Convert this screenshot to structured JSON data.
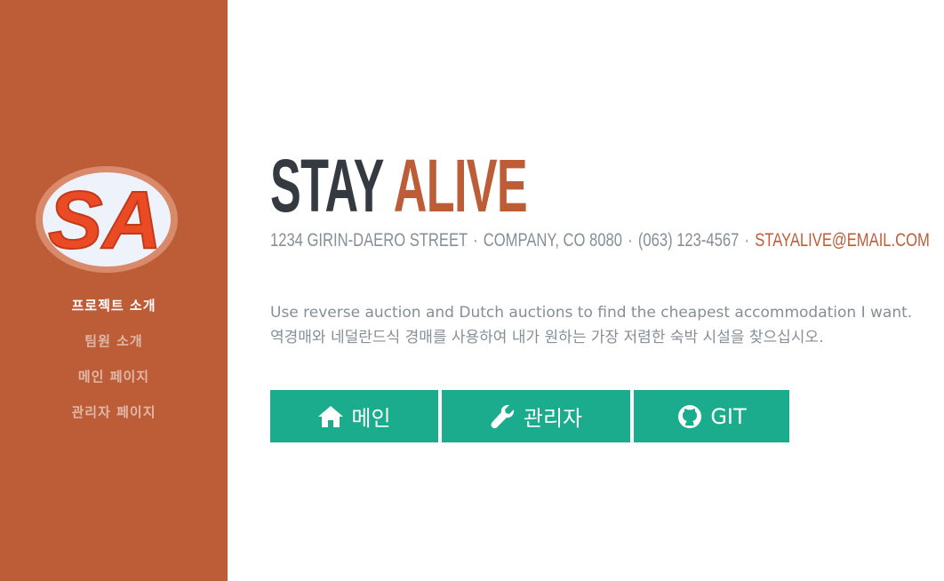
{
  "sidebar": {
    "logo_text": "SA",
    "nav": [
      {
        "label": "프로젝트 소개",
        "active": true
      },
      {
        "label": "팀원 소개",
        "active": false
      },
      {
        "label": "메인 페이지",
        "active": false
      },
      {
        "label": "관리자 페이지",
        "active": false
      }
    ]
  },
  "main": {
    "title_part1": "STAY",
    "title_part2": "ALIVE",
    "subheading": {
      "address": "1234 GIRIN-DAERO STREET",
      "company": "COMPANY, CO 8080",
      "phone": "(063) 123-4567",
      "separator": "·",
      "email": "STAYALIVE@EMAIL.COM"
    },
    "lead_en": "Use reverse auction and Dutch auctions to find the cheapest accommodation I want.",
    "lead_ko": "역경매와 네덜란드식 경매를 사용하여 내가 원하는 가장 저렴한 숙박 시설을 찾으십시오.",
    "buttons": [
      {
        "label": "메인",
        "icon": "home-icon"
      },
      {
        "label": "관리자",
        "icon": "wrench-icon"
      },
      {
        "label": "GIT",
        "icon": "github-icon"
      }
    ]
  },
  "colors": {
    "sidebar_bg": "#bd5d38",
    "title_dark": "#343a40",
    "accent": "#bd5d38",
    "muted_text": "#868e96",
    "button_bg": "#1aac8c"
  }
}
